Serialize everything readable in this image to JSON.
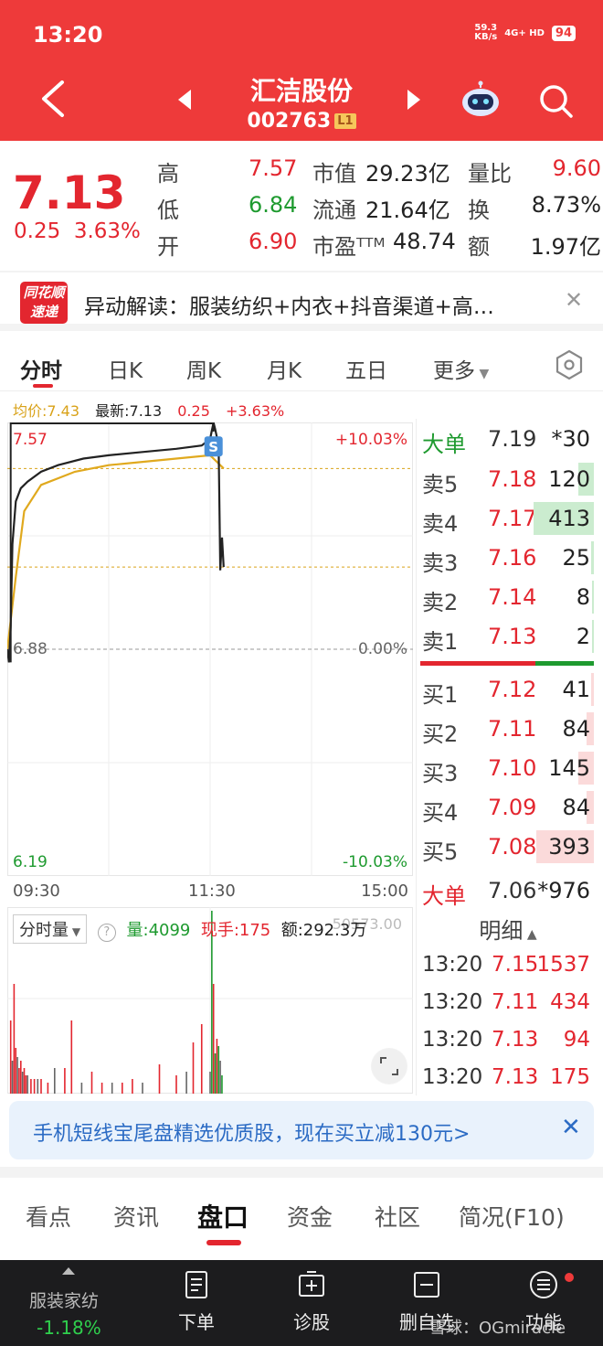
{
  "status": {
    "time": "13:20",
    "net_speed": "59.3",
    "net_unit": "KB/s",
    "network": "4G+ HD",
    "battery": "94"
  },
  "header": {
    "stock_name": "汇洁股份",
    "stock_code": "002763",
    "level": "L1"
  },
  "quote": {
    "price": "7.13",
    "change": "0.25",
    "change_pct": "3.63%",
    "high_label": "高",
    "high": "7.57",
    "low_label": "低",
    "low": "6.84",
    "open_label": "开",
    "open": "6.90",
    "mktcap_label": "市值",
    "mktcap": "29.23亿",
    "float_label": "流通",
    "float": "21.64亿",
    "pe_label": "市盈ᵀᵀᴹ",
    "pe": "48.74",
    "volratio_label": "量比",
    "volratio": "9.60",
    "turnover_label": "换",
    "turnover": "8.73%",
    "amount_label": "额",
    "amount": "1.97亿"
  },
  "alert": {
    "logo_line1": "同花顺",
    "logo_line2": "速递",
    "text": "异动解读：服装纺织+内衣+抖音渠道+高…"
  },
  "chart_tabs": [
    "分时",
    "日K",
    "周K",
    "月K",
    "五日",
    "更多"
  ],
  "info_line": {
    "avg": "均价:7.43",
    "latest": "最新:7.13",
    "chg": "0.25",
    "pct": "+3.63%"
  },
  "chart_labels": {
    "top_price": "7.57",
    "top_pct": "+10.03%",
    "mid_price": "6.88",
    "mid_pct": "0.00%",
    "bot_price": "6.19",
    "bot_pct": "-10.03%",
    "marker": "S"
  },
  "time_axis": [
    "09:30",
    "11:30",
    "15:00"
  ],
  "volume_header": {
    "type": "分时量",
    "vol": "量:4099",
    "now": "现手:175",
    "amt": "额:292.3万",
    "ghost": "50573.00"
  },
  "order_book": {
    "big_sell": {
      "label": "大单",
      "price": "7.19",
      "vol": "*30"
    },
    "sells": [
      {
        "label": "卖5",
        "price": "7.18",
        "vol": "120",
        "fill": 0.25
      },
      {
        "label": "卖4",
        "price": "7.17",
        "vol": "413",
        "fill": 1.0
      },
      {
        "label": "卖3",
        "price": "7.16",
        "vol": "25",
        "fill": 0.04
      },
      {
        "label": "卖2",
        "price": "7.14",
        "vol": "8",
        "fill": 0.02
      },
      {
        "label": "卖1",
        "price": "7.13",
        "vol": "2",
        "fill": 0.01
      }
    ],
    "buys": [
      {
        "label": "买1",
        "price": "7.12",
        "vol": "41",
        "fill": 0.05
      },
      {
        "label": "买2",
        "price": "7.11",
        "vol": "84",
        "fill": 0.12
      },
      {
        "label": "买3",
        "price": "7.10",
        "vol": "145",
        "fill": 0.25
      },
      {
        "label": "买4",
        "price": "7.09",
        "vol": "84",
        "fill": 0.12
      },
      {
        "label": "买5",
        "price": "7.08",
        "vol": "393",
        "fill": 0.95
      }
    ],
    "big_buy": {
      "label": "大单",
      "price": "7.06",
      "vol": "*976"
    },
    "detail_label": "明细",
    "trades": [
      {
        "time": "13:20",
        "price": "7.15",
        "vol": "1537"
      },
      {
        "time": "13:20",
        "price": "7.11",
        "vol": "434"
      },
      {
        "time": "13:20",
        "price": "7.13",
        "vol": "94"
      },
      {
        "time": "13:20",
        "price": "7.13",
        "vol": "175"
      }
    ]
  },
  "ad": {
    "text": "手机短线宝尾盘精选优质股，现在买立减130元>",
    "close": "✕"
  },
  "info_tabs": [
    "看点",
    "资讯",
    "盘口",
    "资金",
    "社区",
    "简况(F10)"
  ],
  "toolbar": {
    "sector": "服装家纺",
    "sector_change": "-1.18%",
    "order": "下单",
    "diagnose": "诊股",
    "remove": "删自选",
    "func": "功能",
    "watermark": "雪球：OGmiracle"
  },
  "chart_data": {
    "type": "line",
    "title": "",
    "x_labels": [
      "09:30",
      "11:30",
      "15:00"
    ],
    "ylim": [
      6.19,
      7.57
    ],
    "prev_close": 6.88,
    "series": [
      {
        "name": "",
        "x": [
          0,
          1,
          2,
          3,
          5,
          8,
          12,
          20,
          30,
          45,
          60,
          80,
          100,
          115,
          120,
          122,
          123,
          125,
          126,
          127,
          128
        ],
        "y": [
          6.88,
          6.84,
          6.95,
          7.2,
          7.33,
          7.37,
          7.39,
          7.42,
          7.44,
          7.46,
          7.47,
          7.48,
          7.49,
          7.5,
          7.52,
          7.57,
          7.55,
          7.5,
          7.12,
          7.22,
          7.13
        ]
      },
      {
        "name": "",
        "x": [
          0,
          5,
          10,
          20,
          40,
          60,
          80,
          100,
          120,
          128
        ],
        "y": [
          6.88,
          7.1,
          7.3,
          7.38,
          7.42,
          7.44,
          7.45,
          7.46,
          7.47,
          7.43
        ]
      }
    ],
    "volume": {
      "x": [
        2,
        3,
        4,
        5,
        6,
        7,
        8,
        9,
        10,
        11,
        12,
        14,
        16,
        18,
        20,
        24,
        28,
        34,
        38,
        44,
        50,
        56,
        62,
        68,
        74,
        80,
        90,
        100,
        106,
        110,
        115,
        120,
        121,
        122,
        123,
        124,
        125,
        126,
        127
      ],
      "y": [
        40,
        18,
        60,
        25,
        20,
        14,
        18,
        12,
        14,
        10,
        10,
        8,
        8,
        8,
        8,
        6,
        14,
        14,
        40,
        6,
        12,
        6,
        6,
        6,
        8,
        6,
        16,
        10,
        12,
        28,
        38,
        12,
        100,
        60,
        22,
        30,
        26,
        18,
        10
      ]
    }
  }
}
